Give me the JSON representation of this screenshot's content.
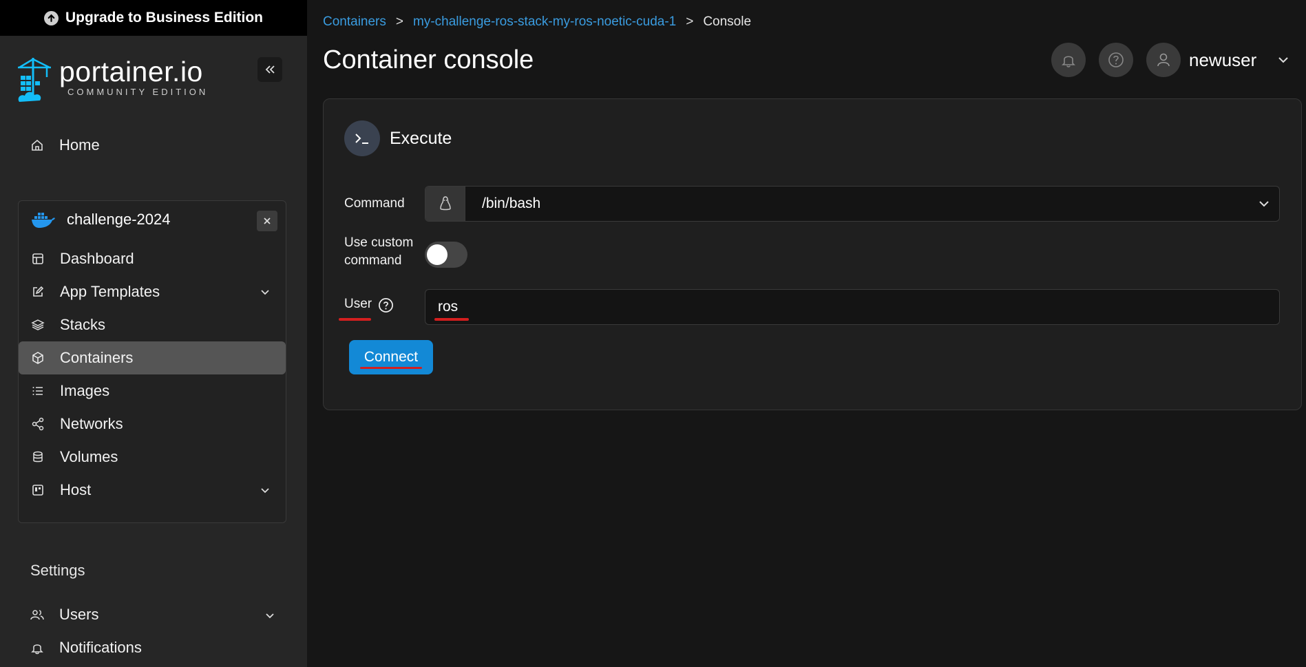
{
  "upgrade_banner": {
    "label": "Upgrade to Business Edition"
  },
  "brand": {
    "name": "portainer.io",
    "subtitle": "COMMUNITY EDITION"
  },
  "sidebar": {
    "home": "Home",
    "environment": {
      "name": "challenge-2024",
      "items": [
        {
          "label": "Dashboard",
          "icon": "dashboard-icon"
        },
        {
          "label": "App Templates",
          "icon": "edit-icon",
          "expandable": true
        },
        {
          "label": "Stacks",
          "icon": "layers-icon"
        },
        {
          "label": "Containers",
          "icon": "box-icon",
          "active": true
        },
        {
          "label": "Images",
          "icon": "list-icon"
        },
        {
          "label": "Networks",
          "icon": "share-icon"
        },
        {
          "label": "Volumes",
          "icon": "database-icon"
        },
        {
          "label": "Host",
          "icon": "host-icon",
          "expandable": true
        }
      ]
    },
    "settings_title": "Settings",
    "settings_items": [
      {
        "label": "Users",
        "icon": "users-icon",
        "expandable": true
      },
      {
        "label": "Notifications",
        "icon": "bell-icon"
      }
    ]
  },
  "breadcrumb": {
    "items": [
      "Containers",
      "my-challenge-ros-stack-my-ros-noetic-cuda-1",
      "Console"
    ],
    "separator": ">"
  },
  "header": {
    "title": "Container console",
    "username": "newuser"
  },
  "panel": {
    "title": "Execute",
    "command_label": "Command",
    "command_value": "/bin/bash",
    "custom_command_label_1": "Use custom",
    "custom_command_label_2": "command",
    "custom_command_enabled": false,
    "user_label": "User",
    "user_value": "ros",
    "connect_label": "Connect"
  },
  "colors": {
    "accent": "#1389d6",
    "link": "#3a9ce0",
    "annotation": "#d31f1f",
    "brand_blue": "#13bef9"
  }
}
